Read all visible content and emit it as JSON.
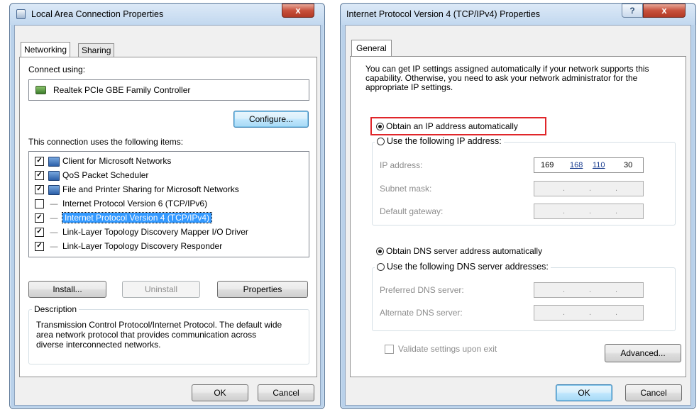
{
  "left_window": {
    "title": "Local Area Connection Properties",
    "close_glyph": "x",
    "tabs": [
      {
        "label": "Networking"
      },
      {
        "label": "Sharing"
      }
    ],
    "connect_using_label": "Connect using:",
    "adapter_name": "Realtek PCIe GBE Family Controller",
    "configure_label": "Configure...",
    "items_label": "This connection uses the following items:",
    "items": [
      {
        "label": "Client for Microsoft Networks",
        "checked": true
      },
      {
        "label": "QoS Packet Scheduler",
        "checked": true
      },
      {
        "label": "File and Printer Sharing for Microsoft Networks",
        "checked": true
      },
      {
        "label": "Internet Protocol Version 6 (TCP/IPv6)",
        "checked": false
      },
      {
        "label": "Internet Protocol Version 4 (TCP/IPv4)",
        "checked": true,
        "selected": true
      },
      {
        "label": "Link-Layer Topology Discovery Mapper I/O Driver",
        "checked": true
      },
      {
        "label": "Link-Layer Topology Discovery Responder",
        "checked": true
      }
    ],
    "check_glyph": "✓",
    "install_label": "Install...",
    "uninstall_label": "Uninstall",
    "properties_label": "Properties",
    "description_label": "Description",
    "description_text": "Transmission Control Protocol/Internet Protocol. The default wide area network protocol that provides communication across diverse interconnected networks.",
    "ok_label": "OK",
    "cancel_label": "Cancel"
  },
  "right_window": {
    "title": "Internet Protocol Version 4 (TCP/IPv4) Properties",
    "help_glyph": "?",
    "close_glyph": "x",
    "tab_label": "General",
    "intro_text": "You can get IP settings assigned automatically if your network supports this capability. Otherwise, you need to ask your network administrator for the appropriate IP settings.",
    "obtain_ip_label": "Obtain an IP address automatically",
    "use_ip_label": "Use the following IP address:",
    "ip_address_label": "IP address:",
    "ip_address_value": {
      "a": "169",
      "b": "168",
      "c": "110",
      "d": "30"
    },
    "subnet_label": "Subnet mask:",
    "gateway_label": "Default gateway:",
    "dot": ".",
    "obtain_dns_label": "Obtain DNS server address automatically",
    "use_dns_label": "Use the following DNS server addresses:",
    "preferred_dns_label": "Preferred DNS server:",
    "alternate_dns_label": "Alternate DNS server:",
    "validate_label": "Validate settings upon exit",
    "advanced_label": "Advanced...",
    "ok_label": "OK",
    "cancel_label": "Cancel"
  },
  "colors": {
    "highlight_box": "#e0262a",
    "selection": "#3399ff"
  }
}
